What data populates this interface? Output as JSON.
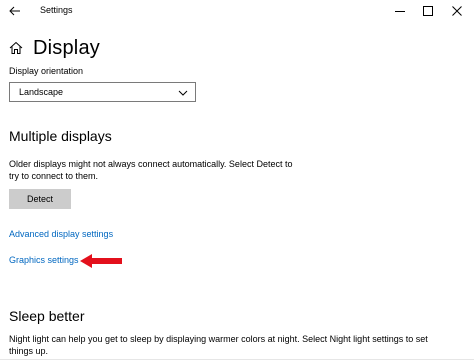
{
  "window": {
    "title": "Settings",
    "controls": {
      "back_icon": "back-arrow-icon",
      "minimize_icon": "minimize-icon",
      "maximize_icon": "maximize-icon",
      "close_icon": "close-icon"
    }
  },
  "header": {
    "home_icon": "home-icon",
    "title": "Display"
  },
  "orientation": {
    "label": "Display orientation",
    "selected": "Landscape"
  },
  "multiple_displays": {
    "title": "Multiple displays",
    "description_line1": "Older displays might not always connect automatically. Select Detect to",
    "description_line2": "try to connect to them.",
    "detect_label": "Detect"
  },
  "links": {
    "advanced": "Advanced display settings",
    "graphics": "Graphics settings"
  },
  "annotation": {
    "arrow_icon": "red-left-arrow-icon",
    "arrow_color": "#e3101c"
  },
  "sleep": {
    "title": "Sleep better",
    "description_line1": "Night light can help you get to sleep by displaying warmer colors at night. Select Night light settings to set",
    "description_line2": "things up."
  },
  "colors": {
    "link": "#0067c0",
    "button": "#cccccc"
  }
}
